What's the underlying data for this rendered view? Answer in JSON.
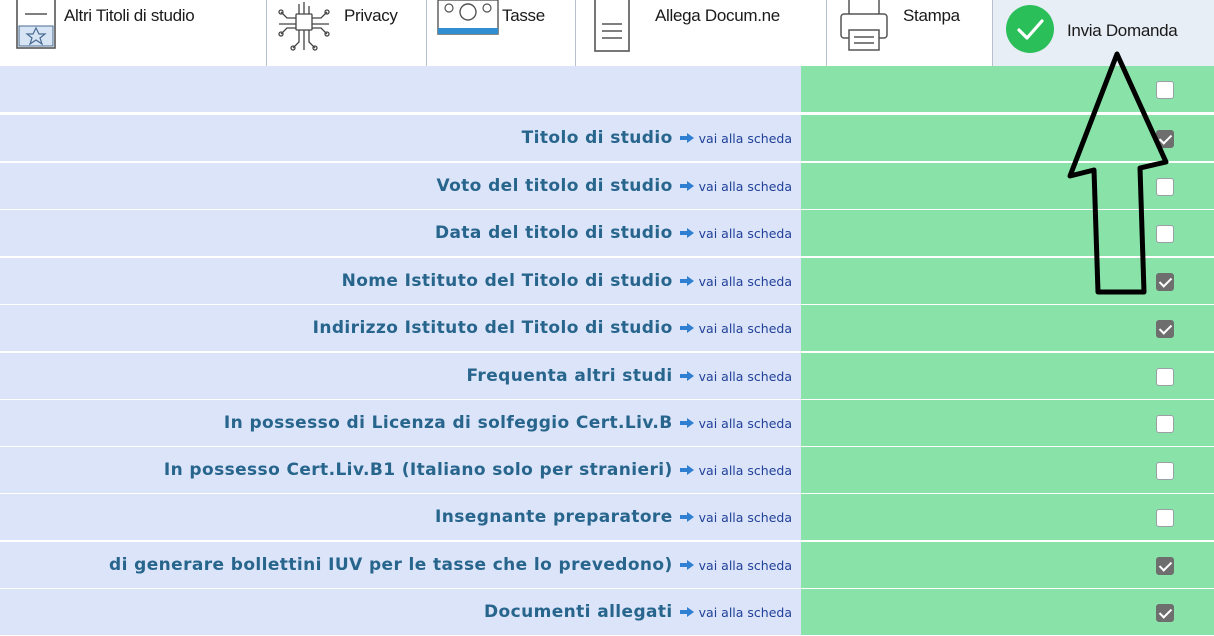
{
  "toolbar": {
    "items": [
      {
        "label": "Altri Titoli di studio",
        "icon": "certificate-icon"
      },
      {
        "label": "Privacy",
        "icon": "circuit-icon"
      },
      {
        "label": "Tasse",
        "icon": "banknote-icon"
      },
      {
        "label": "Allega Docum.ne",
        "icon": "document-icon"
      },
      {
        "label": "Stampa",
        "icon": "printer-icon"
      },
      {
        "label": "Invia Domanda",
        "icon": "check-circle-icon",
        "active": true
      }
    ]
  },
  "link_text": "vai alla scheda",
  "rows": [
    {
      "label": "",
      "checked": false
    },
    {
      "label": "Titolo di studio",
      "checked": true
    },
    {
      "label": "Voto del titolo di studio",
      "checked": false
    },
    {
      "label": "Data del titolo di studio",
      "checked": false
    },
    {
      "label": "Nome Istituto del Titolo di studio",
      "checked": true
    },
    {
      "label": "Indirizzo Istituto del Titolo di studio",
      "checked": true
    },
    {
      "label": "Frequenta altri studi",
      "checked": false
    },
    {
      "label": "In possesso di Licenza di solfeggio Cert.Liv.B",
      "checked": false
    },
    {
      "label": "In possesso Cert.Liv.B1 (Italiano solo per stranieri)",
      "checked": false
    },
    {
      "label": "Insegnante preparatore",
      "checked": false
    },
    {
      "label": "di generare bollettini IUV per le tasse che lo prevedono)",
      "checked": true
    },
    {
      "label": "Documenti allegati",
      "checked": true
    }
  ],
  "colors": {
    "label_blue": "#27658d",
    "link_blue": "#21419a",
    "row_left_bg": "#dbe4f8",
    "row_right_bg": "#89e2a8",
    "active_green": "#2bbf5a",
    "annotation": "#000000"
  }
}
